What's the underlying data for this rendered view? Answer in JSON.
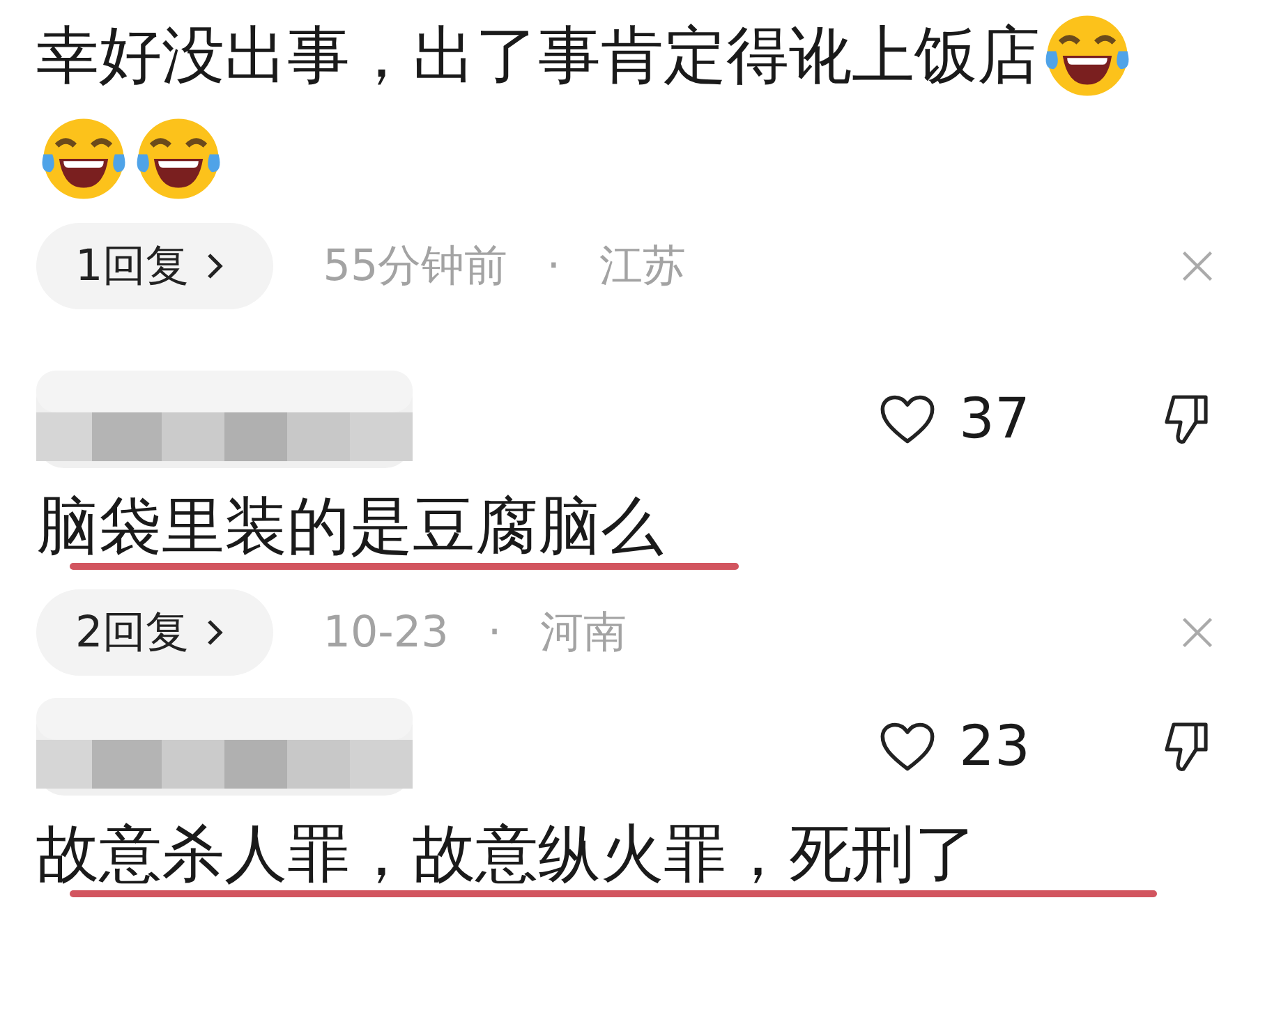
{
  "comments": [
    {
      "kind": "tail",
      "text": "幸好没出事，出了事肯定得讹上饭店",
      "emojis": [
        {
          "kind": "laugh"
        },
        {
          "kind": "laugh"
        },
        {
          "kind": "laugh"
        }
      ],
      "reply_button": "1回复",
      "time": "55分钟前",
      "separator": "·",
      "location": "江苏"
    },
    {
      "kind": "full",
      "likes": "37",
      "text": "脑袋里装的是豆腐脑么",
      "underlined": true,
      "reply_button": "2回复",
      "time": "10-23",
      "separator": "·",
      "location": "河南"
    },
    {
      "kind": "full",
      "likes": "23",
      "text": "故意杀人罪，故意纵火罪，死刑了",
      "underlined": true
    }
  ]
}
